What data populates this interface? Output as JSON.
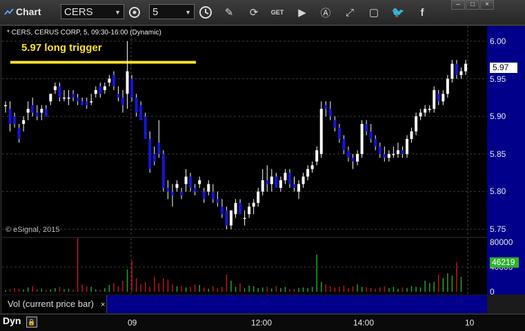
{
  "window": {
    "title": "Chart"
  },
  "toolbar": {
    "symbol": "CERS",
    "interval": "5",
    "icons": [
      "gear-icon",
      "clock-icon",
      "pencil-icon",
      "refresh-icon",
      "get-icon",
      "play-icon",
      "a-icon",
      "cursor-icon",
      "chat-icon",
      "twitter-icon",
      "facebook-icon"
    ]
  },
  "chart": {
    "header": "* CERS, CERUS CORP, 5, 09:30-16:00 (Dynamic)",
    "annotation": "5.97 long trigger",
    "copyright": "© eSignal, 2015",
    "current_price": "5.97",
    "y_ticks": [
      "6.00",
      "5.95",
      "5.90",
      "5.85",
      "5.80",
      "5.75"
    ]
  },
  "volume": {
    "label": "Vol (current price bar)",
    "close": "×",
    "current": "46219",
    "y_ticks": [
      "80000",
      "40000",
      "0"
    ]
  },
  "time_axis": {
    "labels": [
      "09",
      "12:00",
      "14:00",
      "10"
    ]
  },
  "status": {
    "mode": "Dyn"
  },
  "colors": {
    "up": "#ffffff",
    "down": "#1515d8",
    "vol_up": "#22a822",
    "vol_down": "#c01818",
    "trigger": "#ffe32a",
    "axis_bg": "#00008a"
  },
  "chart_data": {
    "type": "candlestick",
    "ylim": [
      5.74,
      6.02
    ],
    "trigger_level": 5.972,
    "candles": [
      [
        5.915,
        5.92,
        5.905,
        5.915
      ],
      [
        5.91,
        5.92,
        5.88,
        5.89
      ],
      [
        5.9,
        5.905,
        5.885,
        5.89
      ],
      [
        5.885,
        5.89,
        5.865,
        5.87
      ],
      [
        5.89,
        5.9,
        5.88,
        5.895
      ],
      [
        5.905,
        5.92,
        5.895,
        5.91
      ],
      [
        5.915,
        5.925,
        5.9,
        5.905
      ],
      [
        5.905,
        5.915,
        5.895,
        5.9
      ],
      [
        5.905,
        5.915,
        5.895,
        5.91
      ],
      [
        5.91,
        5.915,
        5.9,
        5.9
      ],
      [
        5.92,
        5.93,
        5.915,
        5.93
      ],
      [
        5.935,
        5.945,
        5.93,
        5.94
      ],
      [
        5.94,
        5.945,
        5.92,
        5.925
      ],
      [
        5.925,
        5.935,
        5.92,
        5.925
      ],
      [
        5.925,
        5.935,
        5.915,
        5.925
      ],
      [
        5.93,
        5.935,
        5.92,
        5.925
      ],
      [
        5.925,
        5.93,
        5.915,
        5.92
      ],
      [
        5.92,
        5.925,
        5.915,
        5.915
      ],
      [
        5.92,
        5.925,
        5.91,
        5.915
      ],
      [
        5.92,
        5.93,
        5.915,
        5.92
      ],
      [
        5.93,
        5.94,
        5.925,
        5.935
      ],
      [
        5.94,
        5.945,
        5.925,
        5.93
      ],
      [
        5.935,
        5.945,
        5.93,
        5.94
      ],
      [
        5.945,
        5.955,
        5.94,
        5.95
      ],
      [
        5.955,
        5.96,
        5.935,
        5.94
      ],
      [
        5.93,
        5.94,
        5.92,
        5.925
      ],
      [
        5.925,
        5.935,
        5.905,
        5.915
      ],
      [
        5.93,
        6.0,
        5.91,
        5.96
      ],
      [
        5.95,
        5.955,
        5.92,
        5.925
      ],
      [
        5.925,
        5.93,
        5.9,
        5.905
      ],
      [
        5.915,
        5.92,
        5.895,
        5.895
      ],
      [
        5.9,
        5.905,
        5.87,
        5.87
      ],
      [
        5.87,
        5.88,
        5.825,
        5.83
      ],
      [
        5.85,
        5.86,
        5.835,
        5.84
      ],
      [
        5.865,
        5.895,
        5.845,
        5.85
      ],
      [
        5.85,
        5.855,
        5.8,
        5.805
      ],
      [
        5.805,
        5.815,
        5.79,
        5.8
      ],
      [
        5.8,
        5.81,
        5.78,
        5.795
      ],
      [
        5.805,
        5.815,
        5.8,
        5.81
      ],
      [
        5.8,
        5.805,
        5.79,
        5.795
      ],
      [
        5.81,
        5.83,
        5.8,
        5.82
      ],
      [
        5.82,
        5.825,
        5.8,
        5.805
      ],
      [
        5.805,
        5.81,
        5.795,
        5.8
      ],
      [
        5.81,
        5.82,
        5.805,
        5.815
      ],
      [
        5.8,
        5.805,
        5.785,
        5.79
      ],
      [
        5.8,
        5.815,
        5.795,
        5.81
      ],
      [
        5.8,
        5.81,
        5.785,
        5.79
      ],
      [
        5.79,
        5.8,
        5.78,
        5.785
      ],
      [
        5.78,
        5.79,
        5.765,
        5.77
      ],
      [
        5.775,
        5.78,
        5.75,
        5.755
      ],
      [
        5.755,
        5.775,
        5.75,
        5.775
      ],
      [
        5.77,
        5.79,
        5.765,
        5.785
      ],
      [
        5.785,
        5.79,
        5.77,
        5.77
      ],
      [
        5.765,
        5.775,
        5.755,
        5.765
      ],
      [
        5.77,
        5.785,
        5.765,
        5.78
      ],
      [
        5.78,
        5.79,
        5.77,
        5.785
      ],
      [
        5.785,
        5.805,
        5.78,
        5.8
      ],
      [
        5.8,
        5.83,
        5.795,
        5.815
      ],
      [
        5.815,
        5.835,
        5.8,
        5.81
      ],
      [
        5.81,
        5.83,
        5.8,
        5.82
      ],
      [
        5.82,
        5.825,
        5.805,
        5.805
      ],
      [
        5.805,
        5.82,
        5.8,
        5.815
      ],
      [
        5.815,
        5.83,
        5.81,
        5.825
      ],
      [
        5.825,
        5.83,
        5.805,
        5.81
      ],
      [
        5.81,
        5.82,
        5.8,
        5.805
      ],
      [
        5.8,
        5.815,
        5.79,
        5.81
      ],
      [
        5.81,
        5.825,
        5.805,
        5.82
      ],
      [
        5.82,
        5.835,
        5.815,
        5.83
      ],
      [
        5.83,
        5.84,
        5.825,
        5.835
      ],
      [
        5.84,
        5.86,
        5.835,
        5.855
      ],
      [
        5.85,
        5.92,
        5.845,
        5.91
      ],
      [
        5.915,
        5.92,
        5.9,
        5.91
      ],
      [
        5.91,
        5.92,
        5.895,
        5.9
      ],
      [
        5.895,
        5.9,
        5.88,
        5.885
      ],
      [
        5.885,
        5.89,
        5.865,
        5.87
      ],
      [
        5.87,
        5.875,
        5.85,
        5.855
      ],
      [
        5.855,
        5.86,
        5.84,
        5.845
      ],
      [
        5.845,
        5.85,
        5.83,
        5.84
      ],
      [
        5.84,
        5.855,
        5.835,
        5.85
      ],
      [
        5.85,
        5.895,
        5.845,
        5.89
      ],
      [
        5.89,
        5.895,
        5.875,
        5.88
      ],
      [
        5.88,
        5.89,
        5.865,
        5.87
      ],
      [
        5.87,
        5.875,
        5.855,
        5.86
      ],
      [
        5.86,
        5.865,
        5.845,
        5.85
      ],
      [
        5.85,
        5.86,
        5.84,
        5.845
      ],
      [
        5.845,
        5.855,
        5.84,
        5.85
      ],
      [
        5.85,
        5.86,
        5.845,
        5.85
      ],
      [
        5.85,
        5.865,
        5.845,
        5.855
      ],
      [
        5.855,
        5.86,
        5.845,
        5.85
      ],
      [
        5.85,
        5.875,
        5.845,
        5.87
      ],
      [
        5.87,
        5.885,
        5.865,
        5.88
      ],
      [
        5.88,
        5.905,
        5.875,
        5.9
      ],
      [
        5.9,
        5.91,
        5.895,
        5.905
      ],
      [
        5.905,
        5.915,
        5.9,
        5.91
      ],
      [
        5.91,
        5.915,
        5.905,
        5.91
      ],
      [
        5.91,
        5.94,
        5.905,
        5.935
      ],
      [
        5.93,
        5.935,
        5.915,
        5.92
      ],
      [
        5.92,
        5.935,
        5.915,
        5.93
      ],
      [
        5.93,
        5.955,
        5.925,
        5.95
      ],
      [
        5.95,
        5.975,
        5.945,
        5.97
      ],
      [
        5.97,
        5.975,
        5.95,
        5.955
      ],
      [
        5.955,
        5.965,
        5.95,
        5.96
      ],
      [
        5.96,
        5.975,
        5.955,
        5.97
      ]
    ],
    "volume": [
      3000,
      4500,
      6000,
      5000,
      3500,
      7000,
      9000,
      4000,
      5000,
      3000,
      4000,
      6000,
      8000,
      4000,
      5000,
      3000,
      87000,
      12000,
      9000,
      8000,
      4000,
      3000,
      6000,
      11000,
      14000,
      9000,
      18000,
      36000,
      50000,
      22000,
      12000,
      16000,
      8000,
      24000,
      14000,
      22000,
      20000,
      12000,
      9000,
      10000,
      7000,
      8000,
      12000,
      11000,
      7000,
      5000,
      9000,
      6000,
      8000,
      28000,
      18000,
      8000,
      14000,
      6000,
      10000,
      9000,
      6000,
      7000,
      8000,
      5000,
      9000,
      6000,
      8000,
      4000,
      5000,
      6000,
      7000,
      6000,
      8000,
      60000,
      16000,
      12000,
      9000,
      7000,
      8000,
      10000,
      6000,
      9000,
      12000,
      8000,
      7000,
      6000,
      5000,
      7000,
      9000,
      6000,
      8000,
      5000,
      7000,
      6000,
      9000,
      8000,
      7000,
      18000,
      14000,
      16000,
      28000,
      22000,
      30000,
      26000,
      48000,
      24000
    ],
    "vol_ylim": [
      0,
      80000
    ]
  }
}
